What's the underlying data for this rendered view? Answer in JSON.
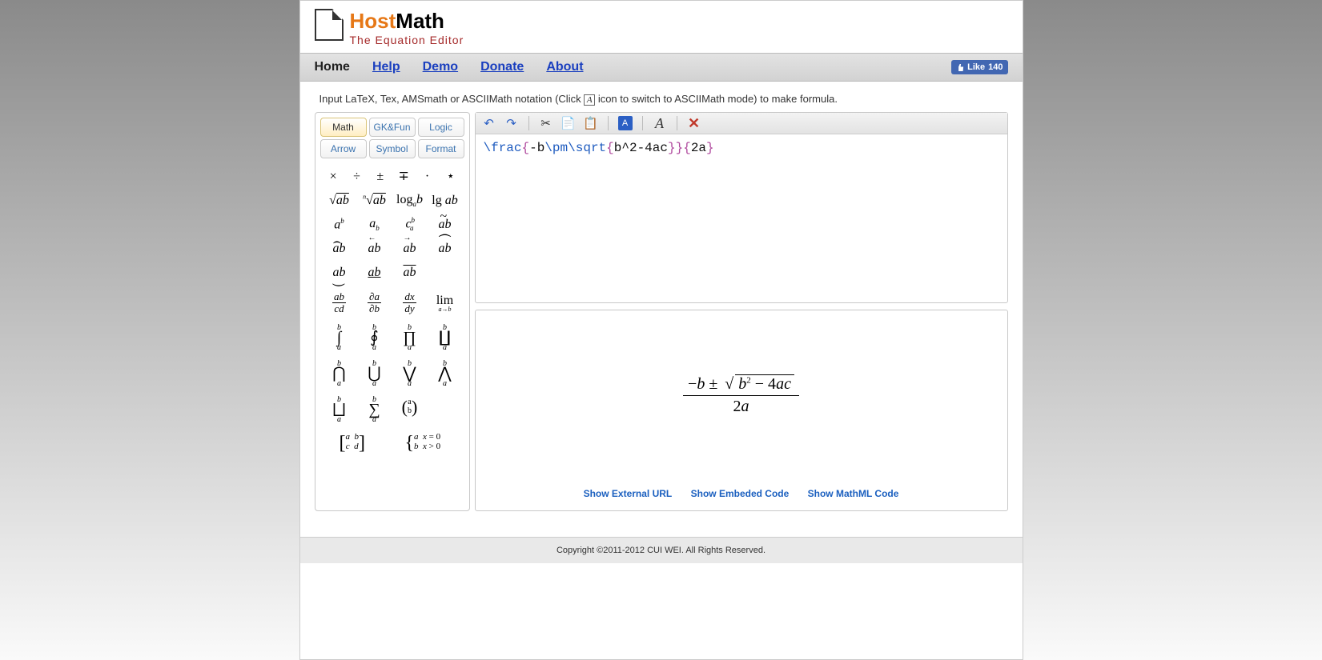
{
  "brand": {
    "host": "Host",
    "math": "Math",
    "tagline": "The Equation Editor"
  },
  "nav": {
    "home": "Home",
    "help": "Help",
    "demo": "Demo",
    "donate": "Donate",
    "about": "About"
  },
  "fb_like": {
    "label": "Like",
    "count": "140"
  },
  "hint": {
    "pre": "Input LaTeX, Tex, AMSmath or ASCIIMath notation (Click ",
    "icon_glyph": "A",
    "post": " icon to switch to ASCIIMath mode) to make formula."
  },
  "palette_tabs": {
    "row1": [
      "Math",
      "GK&Fun",
      "Logic"
    ],
    "row2": [
      "Arrow",
      "Symbol",
      "Format"
    ],
    "active": "Math"
  },
  "editor": {
    "latex_tokens": [
      {
        "t": "cmd",
        "v": "\\frac"
      },
      {
        "t": "brace",
        "v": "{"
      },
      {
        "t": "txt",
        "v": "-b"
      },
      {
        "t": "cmd",
        "v": "\\pm"
      },
      {
        "t": "cmd",
        "v": "\\sqrt"
      },
      {
        "t": "brace",
        "v": "{"
      },
      {
        "t": "txt",
        "v": "b^2-4ac"
      },
      {
        "t": "brace",
        "v": "}"
      },
      {
        "t": "brace",
        "v": "}"
      },
      {
        "t": "brace",
        "v": "{"
      },
      {
        "t": "txt",
        "v": "2a"
      },
      {
        "t": "brace",
        "v": "}"
      }
    ]
  },
  "preview_links": {
    "url": "Show External URL",
    "embed": "Show Embeded Code",
    "mathml": "Show MathML Code"
  },
  "footer": "Copyright ©2011-2012 CUI WEI. All Rights Reserved."
}
